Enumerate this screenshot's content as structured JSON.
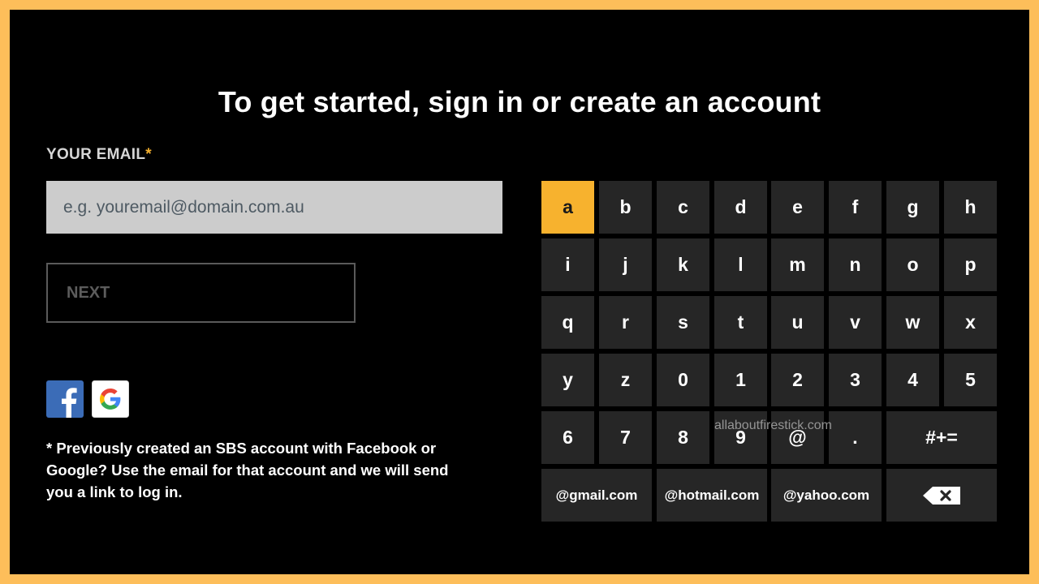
{
  "page": {
    "title": "To get started, sign in or create an account"
  },
  "form": {
    "email_label": "YOUR EMAIL",
    "required_marker": "*",
    "email_placeholder": "e.g. youremail@domain.com.au",
    "email_value": "",
    "next_label": "NEXT"
  },
  "social": {
    "facebook_icon": "facebook-icon",
    "google_icon": "google-icon"
  },
  "note": "* Previously created an SBS account with Facebook or Google? Use the email for that account and we will send you a link to log in.",
  "keyboard": {
    "focused_key": "a",
    "accent_color": "#f7b22e",
    "rows": [
      [
        "a",
        "b",
        "c",
        "d",
        "e",
        "f",
        "g",
        "h"
      ],
      [
        "i",
        "j",
        "k",
        "l",
        "m",
        "n",
        "o",
        "p"
      ],
      [
        "q",
        "r",
        "s",
        "t",
        "u",
        "v",
        "w",
        "x"
      ],
      [
        "y",
        "z",
        "0",
        "1",
        "2",
        "3",
        "4",
        "5"
      ],
      [
        "6",
        "7",
        "8",
        "9",
        "@",
        ".",
        "#+="
      ],
      [
        "@gmail.com",
        "@hotmail.com",
        "@yahoo.com",
        "backspace-icon"
      ]
    ]
  },
  "watermark": "allaboutfirestick.com"
}
